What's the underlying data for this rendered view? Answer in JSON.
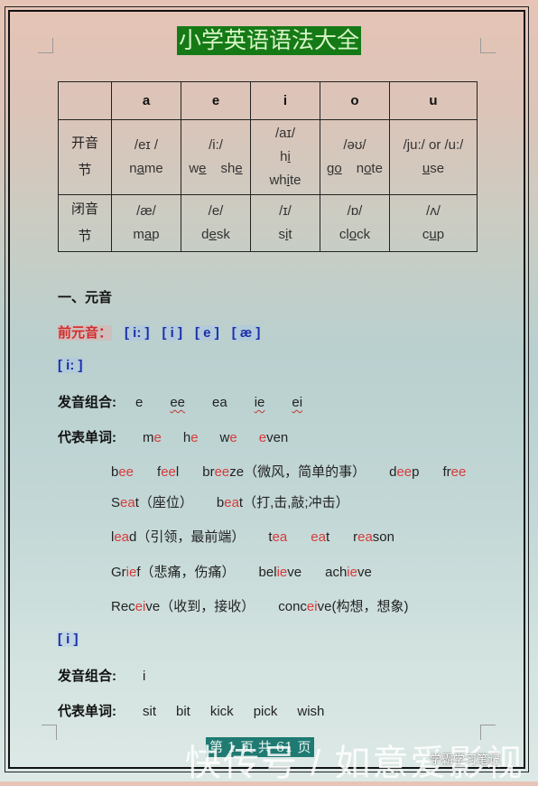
{
  "title": "小学英语语法大全",
  "table": {
    "headers": [
      "",
      "a",
      "e",
      "i",
      "o",
      "u"
    ],
    "open_label": "开音节",
    "open_label_lines": [
      "开音",
      "节"
    ],
    "closed_label_lines": [
      "闭音",
      "节"
    ],
    "open": [
      {
        "ipa": "/eɪ /",
        "words": [
          "name"
        ]
      },
      {
        "ipa": "/i:/",
        "words": [
          "we",
          "she"
        ]
      },
      {
        "ipa": "/aɪ/",
        "words": [
          "hi",
          "white"
        ]
      },
      {
        "ipa": "/əʊ/",
        "words": [
          "go",
          "note"
        ]
      },
      {
        "ipa": "/ju:/ or /u:/",
        "words": [
          "use"
        ]
      }
    ],
    "closed": [
      {
        "ipa": "/æ/",
        "words": [
          "map"
        ]
      },
      {
        "ipa": "/e/",
        "words": [
          "desk"
        ]
      },
      {
        "ipa": "/ɪ/",
        "words": [
          "sit"
        ]
      },
      {
        "ipa": "/ɒ/",
        "words": [
          "clock"
        ]
      },
      {
        "ipa": "/ʌ/",
        "words": [
          "cup"
        ]
      }
    ]
  },
  "section": {
    "title": "一、元音",
    "front_vowels_label": "前元音：",
    "front_vowels": [
      "[ i: ]",
      "[ i ]",
      "[ e ]",
      "[ æ ]"
    ]
  },
  "vowel_ii": {
    "heading": "[ i: ]",
    "combo_label": "发音组合:",
    "combos": [
      "e",
      "ee",
      "ea",
      "ie",
      "ei"
    ],
    "words_label": "代表单词:",
    "words": [
      {
        "pre": "m",
        "hl": "e",
        "post": ""
      },
      {
        "pre": "h",
        "hl": "e",
        "post": ""
      },
      {
        "pre": "w",
        "hl": "e",
        "post": ""
      },
      {
        "pre": "",
        "hl": "e",
        "post": "ven"
      }
    ],
    "examples": [
      [
        {
          "pre": "b",
          "hl": "ee",
          "post": "",
          "gloss": ""
        },
        {
          "pre": "f",
          "hl": "ee",
          "post": "l",
          "gloss": ""
        },
        {
          "pre": "br",
          "hl": "ee",
          "post": "ze",
          "gloss": "（微风，简单的事）"
        },
        {
          "pre": "d",
          "hl": "ee",
          "post": "p",
          "gloss": ""
        },
        {
          "pre": "fr",
          "hl": "ee",
          "post": "",
          "gloss": ""
        }
      ],
      [
        {
          "pre": "S",
          "hl": "ea",
          "post": "t",
          "gloss": "（座位）"
        },
        {
          "pre": "b",
          "hl": "ea",
          "post": "t",
          "gloss": "（打,击,敲;冲击）"
        }
      ],
      [
        {
          "pre": "l",
          "hl": "ea",
          "post": "d",
          "gloss": "（引领，最前端）"
        },
        {
          "pre": "t",
          "hl": "ea",
          "post": "",
          "gloss": ""
        },
        {
          "pre": "",
          "hl": "ea",
          "post": "t",
          "gloss": ""
        },
        {
          "pre": "r",
          "hl": "ea",
          "post": "son",
          "gloss": ""
        }
      ],
      [
        {
          "pre": "Gr",
          "hl": "ie",
          "post": "f",
          "gloss": "（悲痛，伤痛）"
        },
        {
          "pre": "bel",
          "hl": "ie",
          "post": "ve",
          "gloss": ""
        },
        {
          "pre": "ach",
          "hl": "ie",
          "post": "ve",
          "gloss": ""
        }
      ],
      [
        {
          "pre": "Rec",
          "hl": "ei",
          "post": "ve",
          "gloss": "（收到，接收）"
        },
        {
          "pre": "conc",
          "hl": "ei",
          "post": "ve",
          "gloss": "(构想，想象)"
        }
      ]
    ]
  },
  "vowel_i": {
    "heading": "[ i ]",
    "combo_label": "发音组合:",
    "combos": [
      "i"
    ],
    "words_label": "代表单词:",
    "words": [
      "sit",
      "bit",
      "kick",
      "pick",
      "wish"
    ]
  },
  "footer": {
    "page_text": "第 1 页 共 61 页",
    "watermark": "快传号 / 如意爱影视",
    "badge": "学霸学习笔记"
  },
  "colors": {
    "title_bg": "#157a16",
    "title_text": "#d8f5c8",
    "highlight_red": "#d83a3a",
    "phonetic_blue": "#1a2fa8",
    "footer_bg": "#1f7a72"
  }
}
